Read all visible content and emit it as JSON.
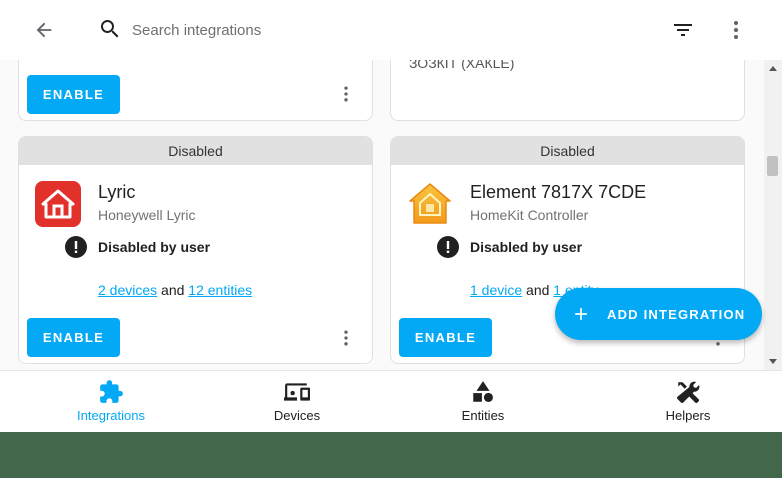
{
  "header": {
    "search": {
      "placeholder": "Search integrations",
      "value": ""
    }
  },
  "partial_cards": {
    "left": {
      "enable_label": "ENABLE"
    },
    "right": {
      "cut_text": "ЗОЗКІТ (ХАКLЕ)"
    }
  },
  "cards": [
    {
      "status_bar": "Disabled",
      "logo_icon": "house-icon",
      "logo_color": "#e2302a",
      "title": "Lyric",
      "subtitle": "Honeywell Lyric",
      "disabled_reason": "Disabled by user",
      "devices_link": "2 devices",
      "and_text": "and",
      "entities_link": "12 entities",
      "enable_label": "ENABLE"
    },
    {
      "status_bar": "Disabled",
      "logo_icon": "homekit-house-icon",
      "logo_color": "#f6a623",
      "title": "Element 7817X 7CDE",
      "subtitle": "HomeKit Controller",
      "disabled_reason": "Disabled by user",
      "devices_link": "1 device",
      "and_text": "and",
      "entities_link": "1 entity",
      "enable_label": "ENABLE"
    }
  ],
  "fab": {
    "label": "ADD INTEGRATION"
  },
  "bottom_nav": {
    "items": [
      {
        "label": "Integrations",
        "icon": "puzzle-icon",
        "active": true
      },
      {
        "label": "Devices",
        "icon": "devices-icon",
        "active": false
      },
      {
        "label": "Entities",
        "icon": "shapes-icon",
        "active": false
      },
      {
        "label": "Helpers",
        "icon": "tools-icon",
        "active": false
      }
    ]
  },
  "colors": {
    "accent": "#03a9f4",
    "status_bar": "#e1e1e1",
    "text_primary": "#212121",
    "text_secondary": "#727272",
    "outer_background": "#42674a"
  }
}
